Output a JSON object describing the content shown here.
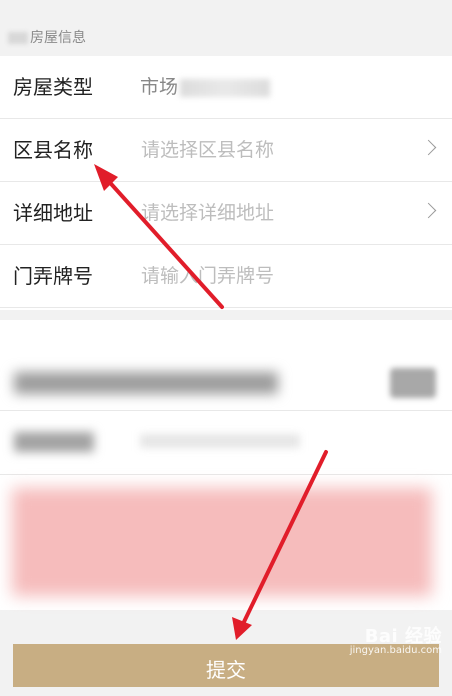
{
  "section": {
    "title": "房屋信息"
  },
  "form": {
    "rows": [
      {
        "label": "房屋类型",
        "value": "市场",
        "placeholder": ""
      },
      {
        "label": "区县名称",
        "value": "",
        "placeholder": "请选择区县名称"
      },
      {
        "label": "详细地址",
        "value": "",
        "placeholder": "请选择详细地址"
      },
      {
        "label": "门弄牌号",
        "value": "",
        "placeholder": "请输入门弄牌号"
      }
    ]
  },
  "submit": {
    "label": "提交"
  },
  "watermark": {
    "main": "Bai 经验",
    "sub": "jingyan.baidu.com"
  },
  "colors": {
    "submit_bg": "#c8ae83",
    "arrow": "#e11d2a"
  }
}
